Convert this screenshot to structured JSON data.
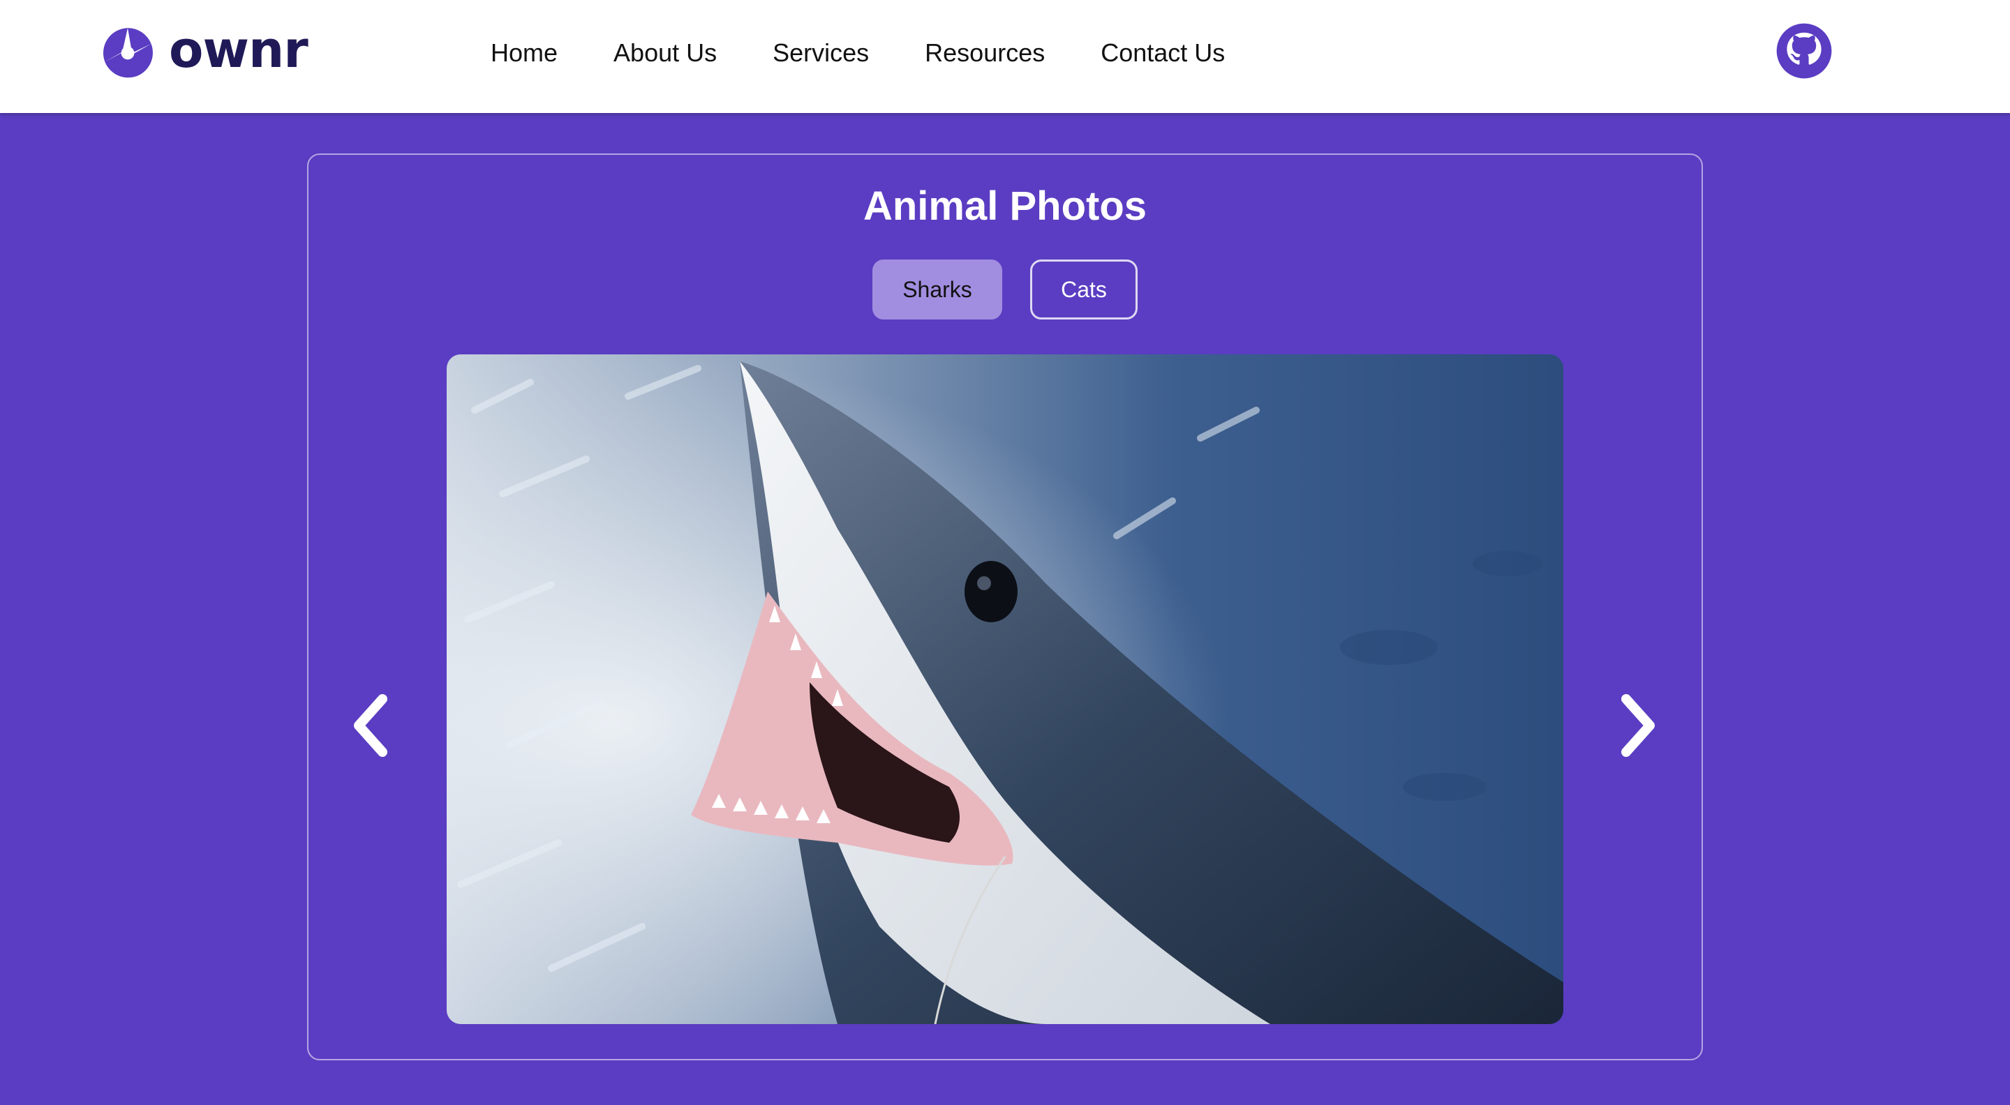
{
  "brand": {
    "name": "ownr",
    "logo_icon": "aperture-icon",
    "accent_color": "#5a3dc2",
    "dark_text_color": "#1f1a57"
  },
  "nav": {
    "items": [
      {
        "label": "Home"
      },
      {
        "label": "About Us"
      },
      {
        "label": "Services"
      },
      {
        "label": "Resources"
      },
      {
        "label": "Contact Us"
      }
    ],
    "github_icon": "github-icon"
  },
  "gallery": {
    "title": "Animal Photos",
    "tabs": [
      {
        "label": "Sharks",
        "active": true
      },
      {
        "label": "Cats",
        "active": false
      }
    ],
    "photo_subject": "shark",
    "prev_icon": "chevron-left-icon",
    "next_icon": "chevron-right-icon"
  }
}
